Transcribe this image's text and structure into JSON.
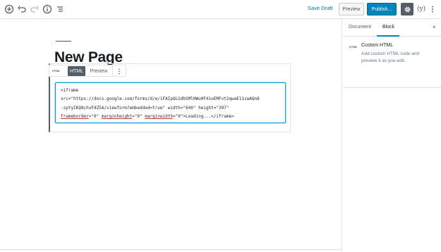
{
  "toolbar": {
    "save_draft": "Save Draft",
    "preview": "Preview",
    "publish": "Publish...",
    "yoast": "(y)",
    "icons": [
      "add-block-icon",
      "undo-icon",
      "redo-icon",
      "info-icon",
      "block-navigation-icon",
      "gear-icon",
      "yoast-icon",
      "more-vertical-icon"
    ],
    "accent_color": "#0085ba"
  },
  "editor": {
    "title": "New Page",
    "block_toolbar": {
      "block_type_label": "HTML",
      "html_tab": "HTML",
      "preview_tab": "Preview"
    },
    "code": {
      "line1": "<iframe",
      "line2": "src=\"https://docs.google.com/forms/d/e/1FAIpQLSdbSMlHWu0F41oEMFvt2qwaE11zwAQn8",
      "line3": "-zpYyIKQ8chxFdZ5A/viewform?embedded=true\" width=\"640\" height=\"397\"",
      "line4_attr1": "frameborder",
      "line4_val1": "=\"0\" ",
      "line4_attr2": "marginheight",
      "line4_val2": "=\"0\" ",
      "line4_attr3": "marginwidth",
      "line4_val3": "=\"0\">Loading...</iframe>"
    }
  },
  "sidebar": {
    "tab_document": "Document",
    "tab_block": "Block",
    "close": "×",
    "block_icon_label": "HTML",
    "block_title": "Custom HTML",
    "block_description": "Add custom HTML code and preview it as you edit."
  }
}
